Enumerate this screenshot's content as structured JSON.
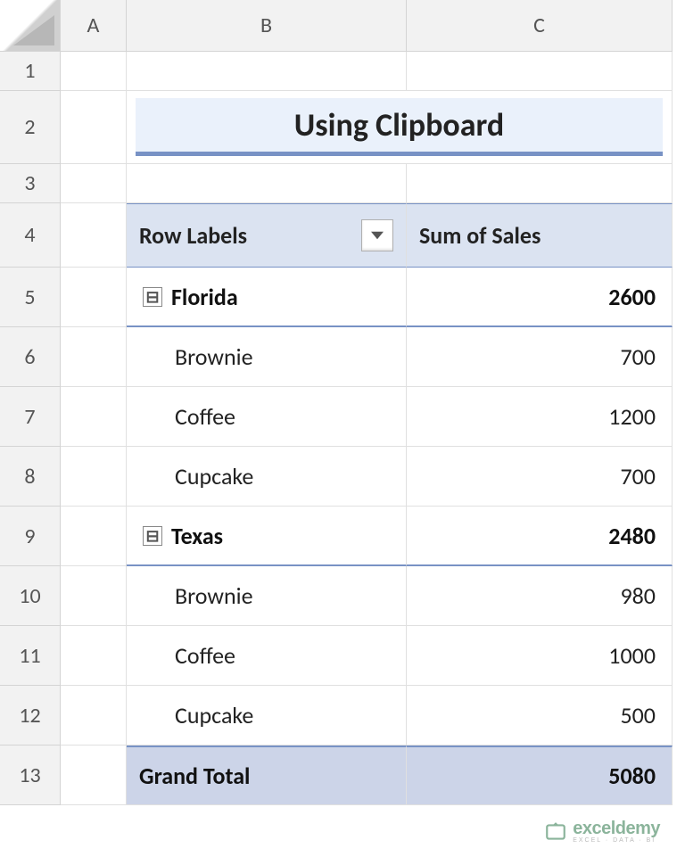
{
  "columns": [
    "A",
    "B",
    "C"
  ],
  "rows": [
    "1",
    "2",
    "3",
    "4",
    "5",
    "6",
    "7",
    "8",
    "9",
    "10",
    "11",
    "12",
    "13"
  ],
  "title": "Using Clipboard",
  "headers": {
    "row_labels": "Row Labels",
    "sum_of_sales": "Sum of Sales"
  },
  "pivot": {
    "groups": [
      {
        "name": "Florida",
        "total": "2600",
        "items": [
          {
            "label": "Brownie",
            "value": "700"
          },
          {
            "label": "Coffee",
            "value": "1200"
          },
          {
            "label": "Cupcake",
            "value": "700"
          }
        ]
      },
      {
        "name": "Texas",
        "total": "2480",
        "items": [
          {
            "label": "Brownie",
            "value": "980"
          },
          {
            "label": "Coffee",
            "value": "1000"
          },
          {
            "label": "Cupcake",
            "value": "500"
          }
        ]
      }
    ],
    "grand_total_label": "Grand Total",
    "grand_total_value": "5080"
  },
  "watermark": {
    "brand": "exceldemy",
    "tagline": "EXCEL · DATA · BI"
  },
  "collapse_glyph": "⊟"
}
